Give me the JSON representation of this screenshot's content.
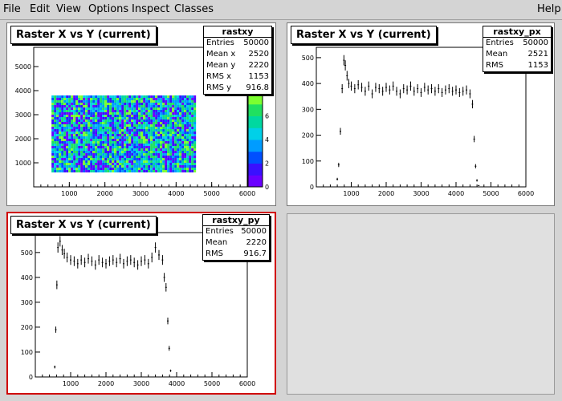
{
  "menu": {
    "file": "File",
    "edit": "Edit",
    "view": "View",
    "options": "Options",
    "inspect": "Inspect",
    "classes": "Classes",
    "help": "Help"
  },
  "colors": {
    "active_border": "#d00000",
    "palette": [
      "#6a00ff",
      "#3a10ff",
      "#0050ff",
      "#009cff",
      "#00d0e8",
      "#00d8a0",
      "#20e060",
      "#7cff30"
    ]
  },
  "pads": [
    {
      "title": "Raster X vs Y (current)",
      "stats": {
        "name": "rastxy",
        "rows": [
          {
            "label": "Entries",
            "value": "50000"
          },
          {
            "label": "Mean x",
            "value": "2520"
          },
          {
            "label": "Mean y",
            "value": "2220"
          },
          {
            "label": "RMS x",
            "value": "1153"
          },
          {
            "label": "RMS y",
            "value": "916.8"
          }
        ]
      }
    },
    {
      "title": "Raster X vs Y (current)",
      "stats": {
        "name": "rastxy_px",
        "rows": [
          {
            "label": "Entries",
            "value": "50000"
          },
          {
            "label": "Mean",
            "value": "2521"
          },
          {
            "label": "RMS",
            "value": "1153"
          }
        ]
      }
    },
    {
      "title": "Raster X vs Y (current)",
      "stats": {
        "name": "rastxy_py",
        "rows": [
          {
            "label": "Entries",
            "value": "50000"
          },
          {
            "label": "Mean",
            "value": "2220"
          },
          {
            "label": "RMS",
            "value": "916.7"
          }
        ]
      }
    }
  ],
  "chart_data": [
    {
      "type": "heatmap",
      "xlim": [
        0,
        6000
      ],
      "ylim": [
        0,
        5800
      ],
      "x_ticks": [
        1000,
        2000,
        3000,
        4000,
        5000,
        6000
      ],
      "y_ticks": [
        1000,
        2000,
        3000,
        4000,
        5000
      ],
      "z_ticks": [
        0,
        2,
        4,
        6
      ],
      "z_range": [
        0,
        8
      ],
      "filled_region": {
        "x": [
          500,
          4550
        ],
        "y": [
          600,
          3800
        ]
      }
    },
    {
      "type": "scatter",
      "xlim": [
        0,
        6000
      ],
      "ylim": [
        0,
        540
      ],
      "y_ticks": [
        0,
        100,
        200,
        300,
        400,
        500
      ],
      "x_ticks": [
        1000,
        2000,
        3000,
        4000,
        5000,
        6000
      ],
      "points": [
        {
          "x": 600,
          "y": 30
        },
        {
          "x": 640,
          "y": 85
        },
        {
          "x": 690,
          "y": 215
        },
        {
          "x": 740,
          "y": 380
        },
        {
          "x": 790,
          "y": 490
        },
        {
          "x": 830,
          "y": 470
        },
        {
          "x": 880,
          "y": 430
        },
        {
          "x": 930,
          "y": 400
        },
        {
          "x": 1000,
          "y": 390
        },
        {
          "x": 1100,
          "y": 380
        },
        {
          "x": 1200,
          "y": 395
        },
        {
          "x": 1300,
          "y": 385
        },
        {
          "x": 1400,
          "y": 370
        },
        {
          "x": 1500,
          "y": 390
        },
        {
          "x": 1600,
          "y": 360
        },
        {
          "x": 1700,
          "y": 385
        },
        {
          "x": 1800,
          "y": 380
        },
        {
          "x": 1900,
          "y": 370
        },
        {
          "x": 2000,
          "y": 385
        },
        {
          "x": 2100,
          "y": 375
        },
        {
          "x": 2200,
          "y": 390
        },
        {
          "x": 2300,
          "y": 370
        },
        {
          "x": 2400,
          "y": 360
        },
        {
          "x": 2500,
          "y": 380
        },
        {
          "x": 2600,
          "y": 375
        },
        {
          "x": 2700,
          "y": 390
        },
        {
          "x": 2800,
          "y": 370
        },
        {
          "x": 2900,
          "y": 380
        },
        {
          "x": 3000,
          "y": 365
        },
        {
          "x": 3100,
          "y": 385
        },
        {
          "x": 3200,
          "y": 375
        },
        {
          "x": 3300,
          "y": 380
        },
        {
          "x": 3400,
          "y": 370
        },
        {
          "x": 3500,
          "y": 380
        },
        {
          "x": 3600,
          "y": 365
        },
        {
          "x": 3700,
          "y": 375
        },
        {
          "x": 3800,
          "y": 380
        },
        {
          "x": 3900,
          "y": 370
        },
        {
          "x": 4000,
          "y": 375
        },
        {
          "x": 4100,
          "y": 365
        },
        {
          "x": 4200,
          "y": 370
        },
        {
          "x": 4300,
          "y": 375
        },
        {
          "x": 4400,
          "y": 360
        },
        {
          "x": 4470,
          "y": 320
        },
        {
          "x": 4520,
          "y": 185
        },
        {
          "x": 4560,
          "y": 80
        },
        {
          "x": 4600,
          "y": 25
        },
        {
          "x": 4650,
          "y": 5
        }
      ]
    },
    {
      "type": "scatter",
      "xlim": [
        0,
        6000
      ],
      "ylim": [
        0,
        580
      ],
      "y_ticks": [
        0,
        100,
        200,
        300,
        400,
        500
      ],
      "x_ticks": [
        1000,
        2000,
        3000,
        4000,
        5000,
        6000
      ],
      "points": [
        {
          "x": 550,
          "y": 40
        },
        {
          "x": 580,
          "y": 190
        },
        {
          "x": 610,
          "y": 370
        },
        {
          "x": 640,
          "y": 520
        },
        {
          "x": 700,
          "y": 545
        },
        {
          "x": 760,
          "y": 510
        },
        {
          "x": 820,
          "y": 495
        },
        {
          "x": 900,
          "y": 480
        },
        {
          "x": 1000,
          "y": 470
        },
        {
          "x": 1100,
          "y": 465
        },
        {
          "x": 1200,
          "y": 455
        },
        {
          "x": 1300,
          "y": 470
        },
        {
          "x": 1400,
          "y": 460
        },
        {
          "x": 1500,
          "y": 475
        },
        {
          "x": 1600,
          "y": 465
        },
        {
          "x": 1700,
          "y": 450
        },
        {
          "x": 1800,
          "y": 470
        },
        {
          "x": 1900,
          "y": 460
        },
        {
          "x": 2000,
          "y": 455
        },
        {
          "x": 2100,
          "y": 465
        },
        {
          "x": 2200,
          "y": 470
        },
        {
          "x": 2300,
          "y": 460
        },
        {
          "x": 2400,
          "y": 475
        },
        {
          "x": 2500,
          "y": 455
        },
        {
          "x": 2600,
          "y": 465
        },
        {
          "x": 2700,
          "y": 470
        },
        {
          "x": 2800,
          "y": 460
        },
        {
          "x": 2900,
          "y": 450
        },
        {
          "x": 3000,
          "y": 465
        },
        {
          "x": 3100,
          "y": 470
        },
        {
          "x": 3200,
          "y": 455
        },
        {
          "x": 3300,
          "y": 480
        },
        {
          "x": 3400,
          "y": 520
        },
        {
          "x": 3500,
          "y": 490
        },
        {
          "x": 3600,
          "y": 470
        },
        {
          "x": 3650,
          "y": 400
        },
        {
          "x": 3700,
          "y": 360
        },
        {
          "x": 3750,
          "y": 225
        },
        {
          "x": 3790,
          "y": 115
        },
        {
          "x": 3830,
          "y": 25
        }
      ]
    }
  ]
}
